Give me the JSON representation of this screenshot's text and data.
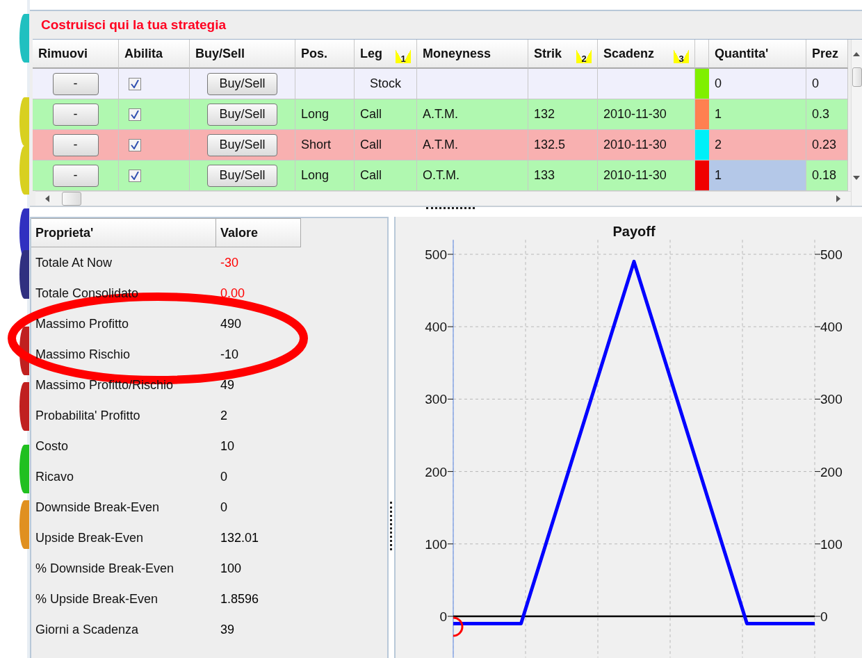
{
  "side_markers": [
    {
      "color": "#20c0c0"
    },
    {
      "color": "#d8d020"
    },
    {
      "color": "#d8d020"
    },
    {
      "color": "#3030c0"
    },
    {
      "color": "#303080"
    },
    {
      "color": "#c02020"
    },
    {
      "color": "#c02020"
    },
    {
      "color": "#20c020"
    },
    {
      "color": "#e09020"
    }
  ],
  "strategy": {
    "title": "Costruisci qui la tua strategia",
    "columns": [
      {
        "label": "Rimuovi"
      },
      {
        "label": "Abilita"
      },
      {
        "label": "Buy/Sell"
      },
      {
        "label": "Pos."
      },
      {
        "label": "Leg",
        "sort_rank": "1"
      },
      {
        "label": "Moneyness"
      },
      {
        "label": "Strik",
        "sort_rank": "2"
      },
      {
        "label": "Scadenz",
        "sort_rank": "3"
      },
      {
        "label": "Quantita'"
      },
      {
        "label": "Prez"
      }
    ],
    "rows": [
      {
        "kind": "stock",
        "remove": "-",
        "checked": true,
        "action": "Buy/Sell",
        "position": "",
        "leg": "Stock",
        "moneyness": "",
        "strike": "",
        "expiry": "",
        "color": "#80f000",
        "quantity": "0",
        "price": "0",
        "selected": false
      },
      {
        "kind": "long",
        "remove": "-",
        "checked": true,
        "action": "Buy/Sell",
        "position": "Long",
        "leg": "Call",
        "moneyness": "A.T.M.",
        "strike": "132",
        "expiry": "2010-11-30",
        "color": "#ff8050",
        "quantity": "1",
        "price": "0.3",
        "selected": false
      },
      {
        "kind": "short",
        "remove": "-",
        "checked": true,
        "action": "Buy/Sell",
        "position": "Short",
        "leg": "Call",
        "moneyness": "A.T.M.",
        "strike": "132.5",
        "expiry": "2010-11-30",
        "color": "#00f0f8",
        "quantity": "2",
        "price": "0.23",
        "selected": false
      },
      {
        "kind": "long",
        "remove": "-",
        "checked": true,
        "action": "Buy/Sell",
        "position": "Long",
        "leg": "Call",
        "moneyness": "O.T.M.",
        "strike": "133",
        "expiry": "2010-11-30",
        "color": "#f00000",
        "quantity": "1",
        "price": "0.18",
        "selected": true
      }
    ]
  },
  "properties": {
    "columns": [
      "Proprieta'",
      "Valore"
    ],
    "rows": [
      {
        "name": "Totale At Now",
        "value": "-30",
        "color": "#ff0000"
      },
      {
        "name": "Totale Consolidato",
        "value": "0.00",
        "color": "#ff0000"
      },
      {
        "name": "Massimo Profitto",
        "value": "490",
        "color": "#000000"
      },
      {
        "name": "Massimo Rischio",
        "value": "-10",
        "color": "#000000"
      },
      {
        "name": "Massimo Profitto/Rischio",
        "value": "49",
        "color": "#000000"
      },
      {
        "name": "Probabilita' Profitto",
        "value": "2",
        "color": "#000000"
      },
      {
        "name": "Costo",
        "value": "10",
        "color": "#000000"
      },
      {
        "name": "Ricavo",
        "value": "0",
        "color": "#000000"
      },
      {
        "name": "Downside Break-Even",
        "value": "0",
        "color": "#000000"
      },
      {
        "name": "Upside Break-Even",
        "value": "132.01",
        "color": "#000000"
      },
      {
        "name": "% Downside Break-Even",
        "value": "100",
        "color": "#000000"
      },
      {
        "name": "% Upside Break-Even",
        "value": "1.8596",
        "color": "#000000"
      },
      {
        "name": "Giorni a Scadenza",
        "value": "39",
        "color": "#000000"
      }
    ]
  },
  "payoff": {
    "right_axis_ticks": [
      "500",
      "400",
      "300",
      "200",
      "100",
      "0"
    ],
    "chart_data": {
      "type": "line",
      "title": "Payoff",
      "ylim": [
        -57,
        520
      ],
      "grid": true,
      "yticks": [
        0,
        100,
        200,
        300,
        400,
        500
      ],
      "series": [
        {
          "color": "#0000ff",
          "values": [
            -10,
            -10,
            -10,
            -10,
            90,
            190,
            290,
            390,
            490,
            390,
            290,
            190,
            90,
            -10,
            -10,
            -10,
            -10
          ]
        }
      ]
    }
  }
}
